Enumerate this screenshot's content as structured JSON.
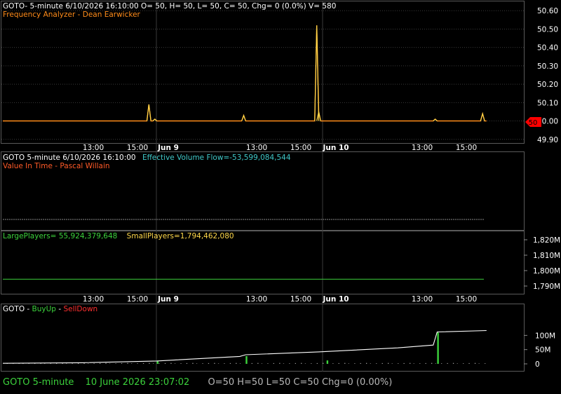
{
  "panel1": {
    "header": "GOTO- 5-minute 6/10/2026 16:10:00 O= 50, H= 50, L= 50, C= 50, Chg= 0 (0.0%) V= 580",
    "subtitle": "Frequency Analyzer - Dean Earwicker",
    "last_price_tag": "50"
  },
  "panel2": {
    "header_prefix": "GOTO 5-minute  6/10/2026 16:10:00",
    "header_indicator": "Effective Volume Flow=-53,599,084,544",
    "subtitle": "Value In Time - Pascal Willain"
  },
  "panel3": {
    "large_label": "LargePlayers= 55,924,379,648",
    "small_label": "SmallPlayers=1,794,462,080"
  },
  "panel4": {
    "title_prefix": "GOTO - ",
    "buy_label": "BuyUp",
    "sep": "-",
    "sell_label": "SellDown"
  },
  "time_axis": [
    "13:00",
    "15:00",
    "Jun 9",
    "13:00",
    "15:00",
    "Jun 10",
    "13:00",
    "15:00"
  ],
  "status_bar": {
    "symbol_interval": "GOTO  5-minute",
    "datetime": "10 June 2026 23:07:02",
    "ohlc": "O=50  H=50  L=50  C=50  Chg=0 (0.00%)"
  },
  "colors": {
    "background": "#000000",
    "price_line": "#ff8c1a",
    "price_spike": "#ffd84a",
    "green": "#3cd23c",
    "orange_text": "#ff8c1a",
    "cyan_text": "#40c8c8",
    "yellow_text": "#ffd84a",
    "red_text": "#ff3030",
    "price_tag": "#ff0000"
  },
  "chart_data": [
    {
      "type": "line",
      "name_key": "price",
      "ylim": [
        49.88,
        50.62
      ],
      "y_ticks": [
        "50.60",
        "50.50",
        "50.40",
        "50.30",
        "50.20",
        "50.10",
        "50.00",
        "49.90"
      ],
      "y_tick_values": [
        50.6,
        50.5,
        50.4,
        50.3,
        50.2,
        50.1,
        50.0,
        49.9
      ],
      "n_bars": 240,
      "baseline": 50.0,
      "spikes": [
        [
          74,
          50.09
        ],
        [
          77,
          50.01
        ],
        [
          122,
          50.03
        ],
        [
          159,
          50.52
        ],
        [
          160,
          50.05
        ],
        [
          219,
          50.01
        ],
        [
          243,
          50.04
        ]
      ]
    },
    {
      "type": "line",
      "name_key": "effective_volume_flow",
      "flat_value_fraction": 0.62
    },
    {
      "type": "line",
      "name_key": "large_players",
      "ylim": [
        1785,
        1825
      ],
      "y_ticks": [
        "1,820M",
        "1,810M",
        "1,800M",
        "1,790M"
      ],
      "y_tick_values": [
        1820,
        1810,
        1800,
        1790
      ],
      "flat_value": 1794.46
    },
    {
      "type": "bar",
      "name_key": "volume",
      "ylim": [
        -5,
        140
      ],
      "y_ticks": [
        "100M",
        "50M",
        "0"
      ],
      "y_tick_values": [
        100,
        50,
        0
      ],
      "cumulative_line": [
        [
          0,
          2
        ],
        [
          40,
          4
        ],
        [
          78,
          10
        ],
        [
          120,
          26
        ],
        [
          123,
          32
        ],
        [
          160,
          42
        ],
        [
          200,
          56
        ],
        [
          218,
          66
        ],
        [
          220,
          112
        ],
        [
          245,
          117
        ]
      ],
      "tall_bars": [
        [
          78,
          11
        ],
        [
          123,
          27
        ],
        [
          164,
          12
        ],
        [
          220,
          110
        ]
      ]
    }
  ]
}
